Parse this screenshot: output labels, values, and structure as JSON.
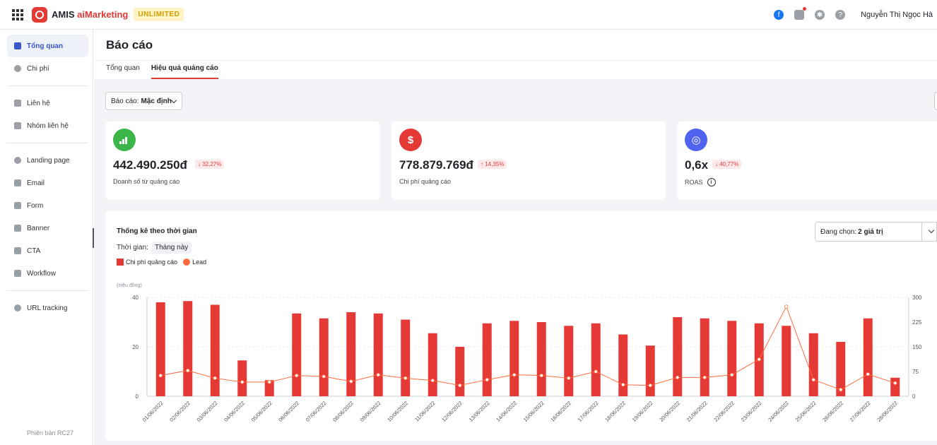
{
  "topbar": {
    "brand_a": "AMIS ",
    "brand_b": "aiMarketing",
    "badge": "UNLIMITED",
    "user_name": "Nguyễn Thị Ngọc Hà"
  },
  "sidebar": {
    "items": [
      {
        "label": "Tổng quan",
        "icon": "chart-icon",
        "active": true
      },
      {
        "label": "Chi phí",
        "icon": "coin-icon"
      },
      {
        "label": "Liên hệ",
        "icon": "contacts-icon"
      },
      {
        "label": "Nhóm liên hệ",
        "icon": "group-icon"
      },
      {
        "label": "Landing page",
        "icon": "cloud-icon"
      },
      {
        "label": "Email",
        "icon": "mail-icon"
      },
      {
        "label": "Form",
        "icon": "form-icon"
      },
      {
        "label": "Banner",
        "icon": "banner-icon"
      },
      {
        "label": "CTA",
        "icon": "cta-icon"
      },
      {
        "label": "Workflow",
        "icon": "workflow-icon"
      },
      {
        "label": "URL tracking",
        "icon": "link-icon"
      }
    ],
    "version": "Phiên bản RC27"
  },
  "page": {
    "title": "Báo cáo",
    "tabs": [
      "Tổng quan",
      "Hiệu quả quảng cáo"
    ],
    "report_label": "Báo cáo:",
    "report_value": "Mặc định"
  },
  "kpis": [
    {
      "value": "442.490.250đ",
      "change": "↓ 32,27%",
      "label": "Doanh số từ quảng cáo",
      "color": "#3cb648",
      "icon": "growth-icon"
    },
    {
      "value": "778.879.769đ",
      "change": "↑ 14,35%",
      "label": "Chi phí quảng cáo",
      "color": "#e53935",
      "icon": "dollar-icon"
    },
    {
      "value": "0,6x",
      "change": "↓ 40,77%",
      "label": "ROAS",
      "color": "#4f63f0",
      "icon": "roas-icon"
    }
  ],
  "chart_panel": {
    "title": "Thống kê theo thời gian",
    "time_label": "Thời gian:",
    "time_value": "Tháng này",
    "select_label": "Đang chọn:",
    "select_value": "2 giá trị"
  },
  "chart_data": {
    "type": "bar",
    "categories": [
      "01/06/2022",
      "02/06/2022",
      "03/06/2022",
      "04/06/2022",
      "05/06/2022",
      "06/06/2022",
      "07/06/2022",
      "08/06/2022",
      "09/06/2022",
      "10/06/2022",
      "11/06/2022",
      "12/06/2022",
      "13/06/2022",
      "14/06/2022",
      "15/06/2022",
      "16/06/2022",
      "17/06/2022",
      "18/06/2022",
      "19/06/2022",
      "20/06/2022",
      "21/06/2022",
      "22/06/2022",
      "23/06/2022",
      "24/06/2022",
      "25/06/2022",
      "26/06/2022",
      "27/06/2022",
      "28/06/2022"
    ],
    "series": [
      {
        "name": "Chi phí quảng cáo",
        "type": "bar",
        "axis": "left",
        "color": "#e53935",
        "values": [
          38,
          38.5,
          37,
          14.5,
          6.5,
          33.5,
          31.5,
          34,
          33.5,
          31,
          25.5,
          20,
          29.5,
          30.5,
          30,
          28.5,
          29.5,
          25,
          20.5,
          32,
          31.5,
          30.5,
          29.5,
          28.5,
          25.5,
          22,
          31.5,
          7.5
        ]
      },
      {
        "name": "Lead",
        "type": "line",
        "axis": "right",
        "color": "#ff6b3d",
        "values": [
          63,
          78,
          55,
          43,
          43,
          63,
          60,
          45,
          65,
          55,
          48,
          33,
          50,
          65,
          63,
          55,
          75,
          35,
          33,
          57,
          57,
          65,
          112,
          272,
          50,
          20,
          67,
          40
        ]
      }
    ],
    "ylabel": "(triệu đồng)",
    "ylim": [
      0,
      40
    ],
    "yticks": [
      "0",
      "20",
      "40"
    ],
    "y2lim": [
      0,
      300
    ],
    "y2ticks": [
      "0",
      "75",
      "150",
      "225",
      "300"
    ],
    "grid": true
  }
}
